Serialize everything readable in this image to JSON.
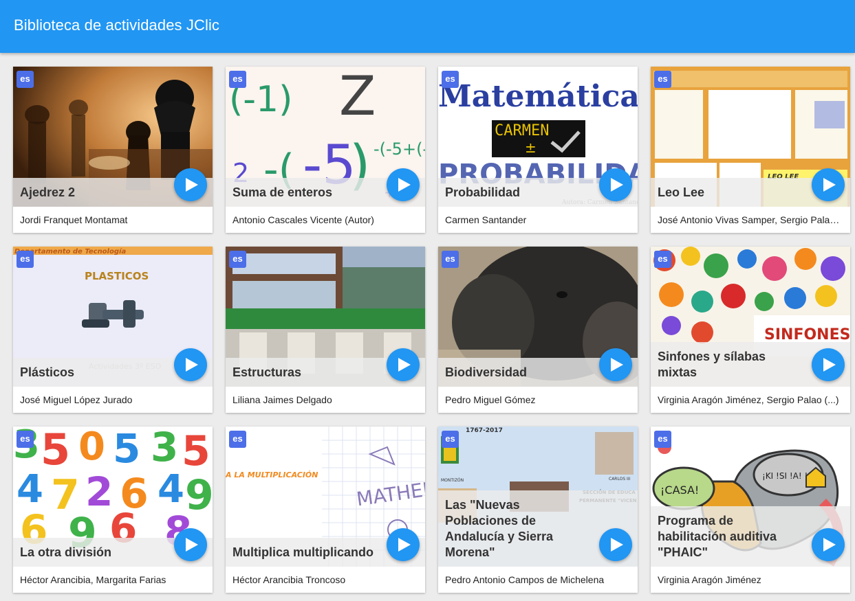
{
  "appbar": {
    "title": "Biblioteca de actividades JClic"
  },
  "cards": [
    {
      "lang": "es",
      "title": "Ajedrez 2",
      "author": "Jordi Franquet Montamat",
      "thumb_icon": "chess-pieces-image"
    },
    {
      "lang": "es",
      "title": "Suma de enteros",
      "author": "Antonio Cascales Vicente (Autor)",
      "thumb_icon": "integer-numbers-image"
    },
    {
      "lang": "es",
      "title": "Probabilidad",
      "author": "Carmen Santander",
      "thumb_icon": "matematica-probabilidad-image",
      "thumb_text": {
        "top": "Matemática",
        "box": "CARMEN",
        "bottom": "PROBABILIDAD",
        "small": "Autora: Carmen Santander"
      }
    },
    {
      "lang": "es",
      "title": "Leo Lee",
      "author": "José Antonio Vivas Samper, Sergio Palao (...)",
      "thumb_icon": "leo-lee-screens-image",
      "thumb_text": {
        "label": "LEO LEE"
      }
    },
    {
      "lang": "es",
      "title": "Plásticos",
      "author": "José Miguel López Jurado",
      "thumb_icon": "plastic-pipes-image",
      "thumb_text": {
        "top": "Departamento de Tecnología",
        "mid": "PLASTICOS",
        "bottom": "Actividades 3º ESO"
      }
    },
    {
      "lang": "es",
      "title": "Estructuras",
      "author": "Liliana Jaimes Delgado",
      "thumb_icon": "school-building-image"
    },
    {
      "lang": "es",
      "title": "Biodiversidad",
      "author": "Pedro Miguel Gómez",
      "thumb_icon": "wild-boar-image"
    },
    {
      "lang": "es",
      "title": "Sinfones y sílabas mixtas",
      "author": "Virginia Aragón Jiménez, Sergio Palao (...)",
      "thumb_icon": "colorful-objects-image",
      "thumb_text": {
        "label": "SINFONES"
      }
    },
    {
      "lang": "es",
      "title": "La otra división",
      "author": "Héctor Arancibia, Margarita Farias",
      "thumb_icon": "colorful-numbers-image"
    },
    {
      "lang": "es",
      "title": "Multiplica multiplicando",
      "author": "Héctor Arancibia Troncoso",
      "thumb_icon": "math-doodles-image",
      "thumb_text": {
        "label": "A LA MULTIPLICACIÓN",
        "doodle": "MATHEMA"
      }
    },
    {
      "lang": "es",
      "title": "Las \"Nuevas Poblaciones de Andalucía y Sierra Morena\"",
      "author": "Pedro Antonio Campos de Michelena",
      "thumb_icon": "history-collage-image",
      "thumb_text": {
        "date": "1767-2017",
        "place": "MONTIZÓN",
        "king": "CARLOS III",
        "section": "SECCIÓN DE EDUCA",
        "section2": "PERMANENTE \"VICEN"
      }
    },
    {
      "lang": "es",
      "title": "Programa de habilitación auditiva \"PHAIC\"",
      "author": "Virginia Aragón Jiménez",
      "thumb_icon": "ear-speech-image",
      "thumb_text": {
        "bubble1": "¡CASA!",
        "bubble2": "¡KI !SI !A! !A!"
      }
    }
  ]
}
